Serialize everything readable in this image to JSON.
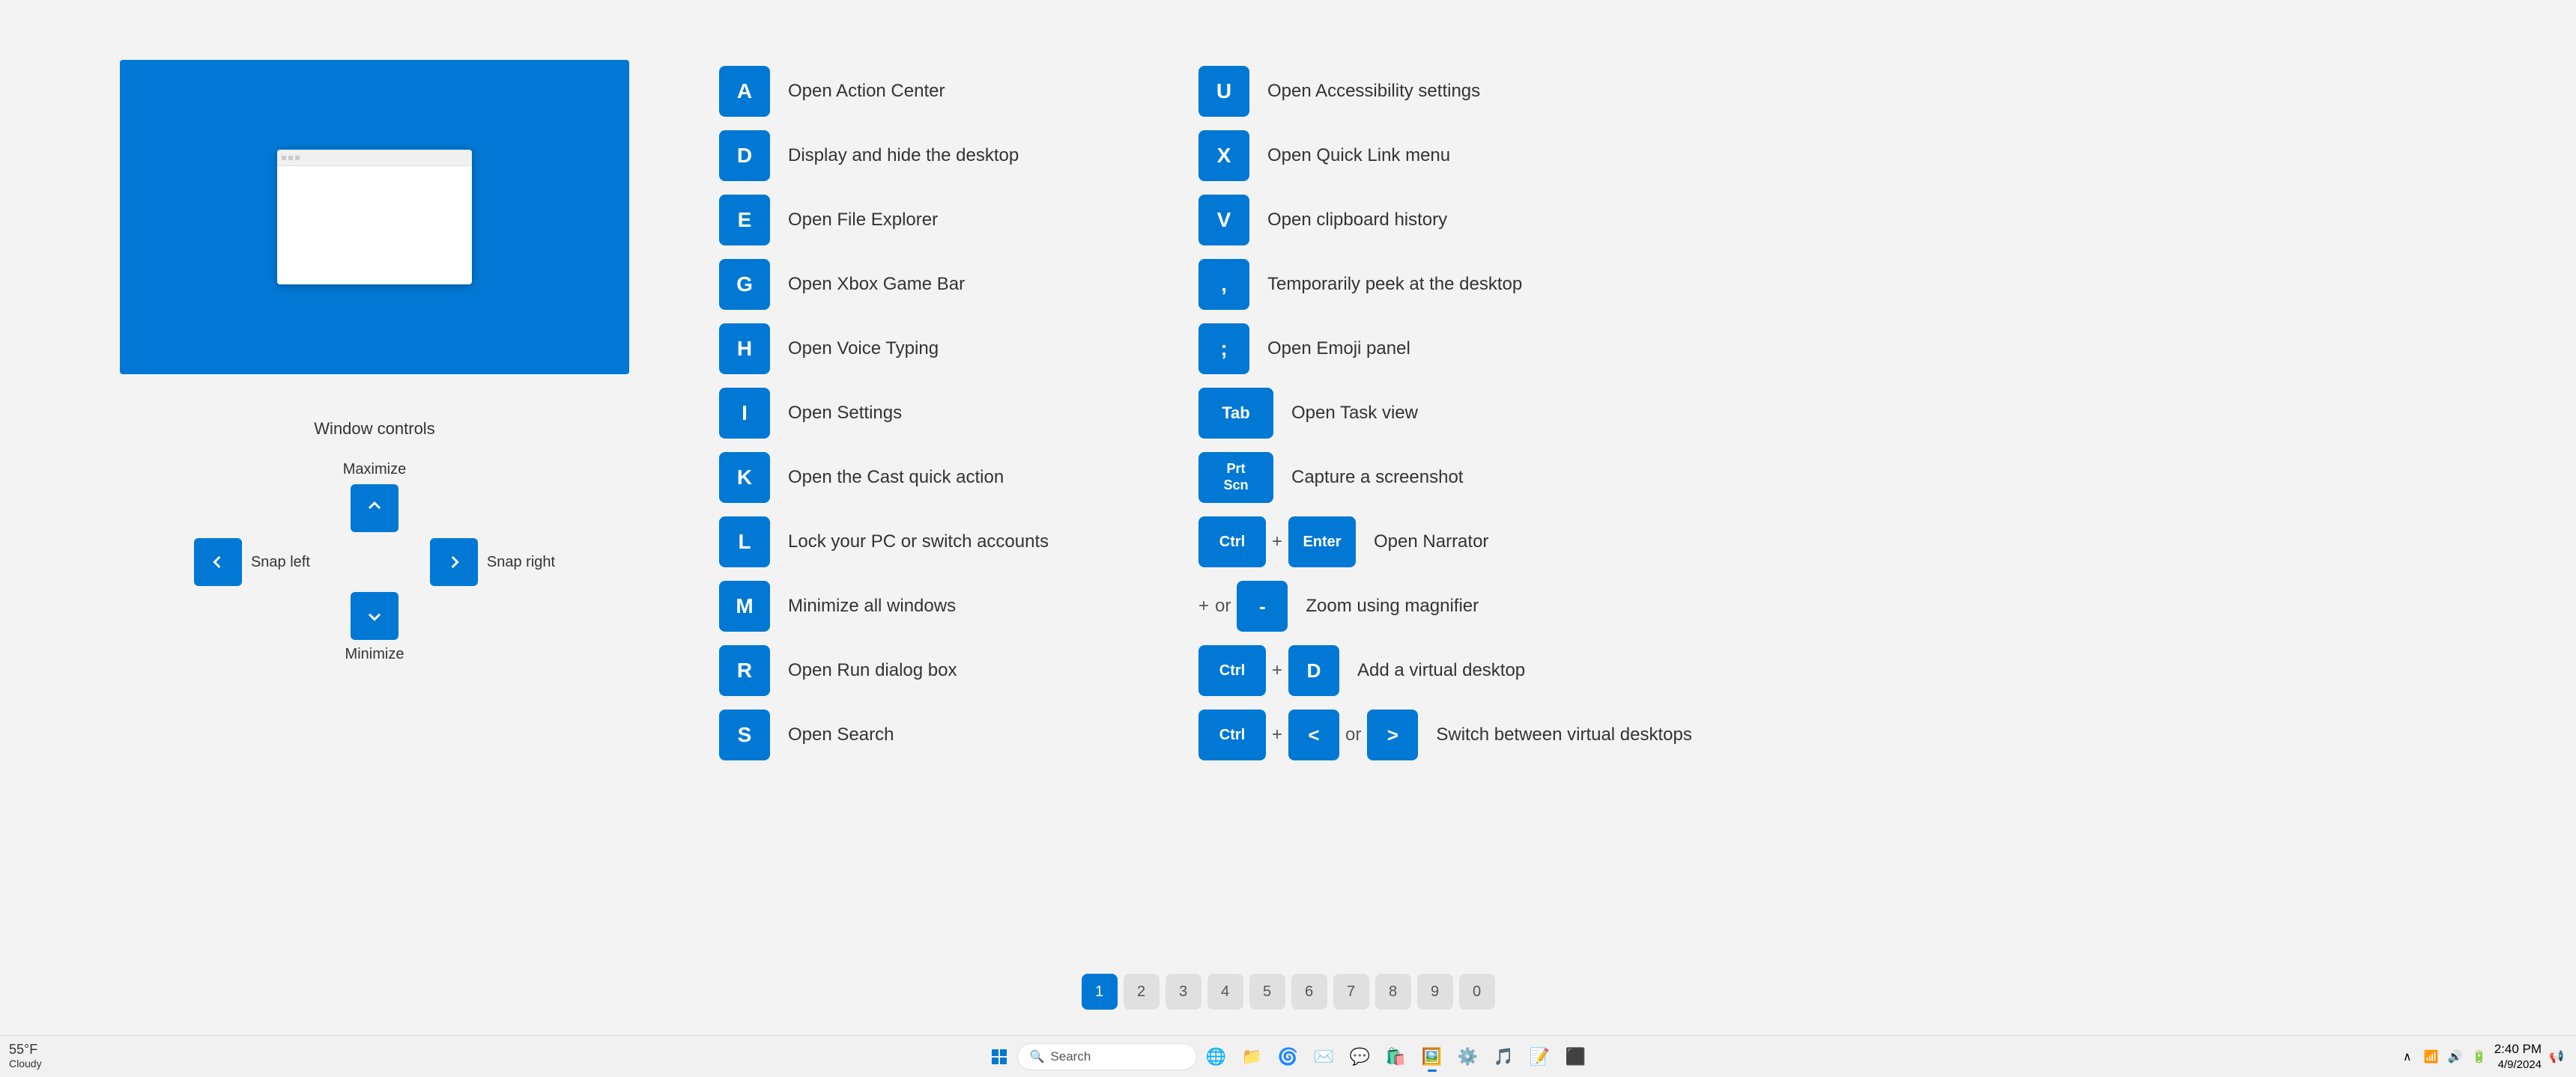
{
  "page": {
    "background": "#f3f3f3"
  },
  "left_panel": {
    "window_controls_title": "Window controls",
    "maximize_label": "Maximize",
    "snap_left_label": "Snap left",
    "snap_right_label": "Snap right",
    "minimize_label": "Minimize"
  },
  "shortcuts_left": [
    {
      "key": "A",
      "desc": "Open Action Center"
    },
    {
      "key": "D",
      "desc": "Display and hide the desktop"
    },
    {
      "key": "E",
      "desc": "Open File Explorer"
    },
    {
      "key": "G",
      "desc": "Open Xbox Game Bar"
    },
    {
      "key": "H",
      "desc": "Open Voice Typing"
    },
    {
      "key": "I",
      "desc": "Open Settings"
    },
    {
      "key": "K",
      "desc": "Open the Cast quick action"
    },
    {
      "key": "L",
      "desc": "Lock your PC or switch accounts"
    },
    {
      "key": "M",
      "desc": "Minimize all windows"
    },
    {
      "key": "R",
      "desc": "Open Run dialog box"
    },
    {
      "key": "S",
      "desc": "Open Search"
    }
  ],
  "shortcuts_right": [
    {
      "key": "U",
      "desc": "Open Accessibility settings",
      "combo": null
    },
    {
      "key": "X",
      "desc": "Open Quick Link menu",
      "combo": null
    },
    {
      "key": "V",
      "desc": "Open clipboard history",
      "combo": null
    },
    {
      "key": ",",
      "desc": "Temporarily peek at the desktop",
      "combo": null
    },
    {
      "key": ";",
      "desc": "Open Emoji panel",
      "combo": null
    },
    {
      "key": "Tab",
      "desc": "Open Task view",
      "combo": null,
      "type": "tab"
    },
    {
      "key": "PrtScn",
      "desc": "Capture a screenshot",
      "combo": null,
      "type": "prtscn"
    },
    {
      "key": "Ctrl+Enter",
      "desc": "Open Narrator",
      "combo": true,
      "keys": [
        "Ctrl",
        "+",
        "Enter"
      ]
    },
    {
      "key": "+-",
      "desc": "Zoom using magnifier",
      "combo": true,
      "keys": [
        "+",
        "or",
        "-"
      ]
    },
    {
      "key": "Ctrl+D",
      "desc": "Add a virtual desktop",
      "combo": true,
      "keys": [
        "Ctrl",
        "+",
        "D"
      ]
    },
    {
      "key": "Ctrl+arrows",
      "desc": "Switch between virtual desktops",
      "combo": true,
      "keys": [
        "Ctrl",
        "+",
        "<",
        "or",
        ">"
      ]
    }
  ],
  "pagination": {
    "pages": [
      "1",
      "2",
      "3",
      "4",
      "5",
      "6",
      "7",
      "8",
      "9",
      "0"
    ],
    "active": 0
  },
  "taskbar": {
    "weather": "55°F\nCloudy",
    "search_placeholder": "Search",
    "clock_time": "2:40 PM",
    "clock_date": "4/9/2024",
    "start_icon": "⊞",
    "search_icon": "🔍"
  }
}
